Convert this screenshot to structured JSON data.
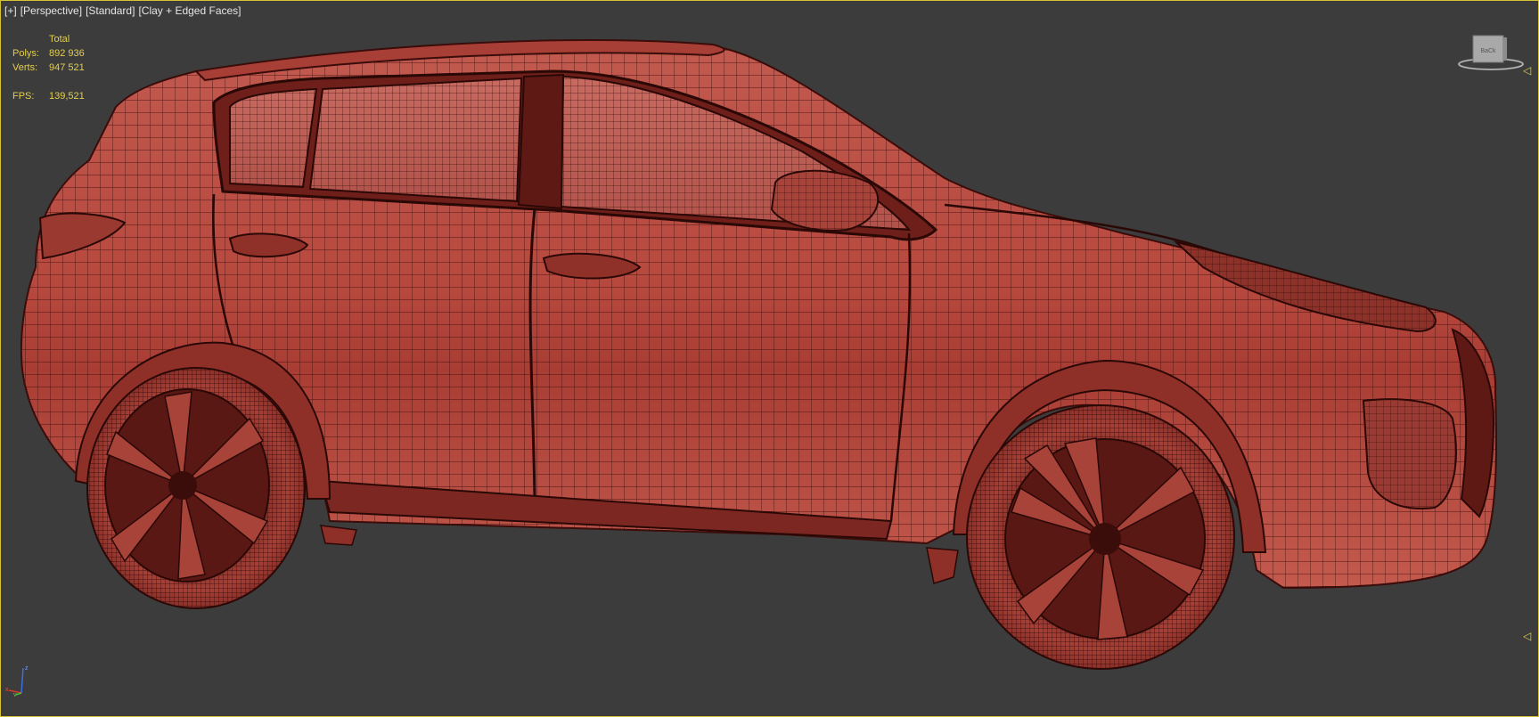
{
  "viewport": {
    "label_plus": "[+]",
    "label_view": "[Perspective]",
    "label_shading_mode": "[Standard]",
    "label_render_mode": "[Clay + Edged Faces]"
  },
  "stats": {
    "header": "Total",
    "polys_label": "Polys:",
    "polys_value": "892 936",
    "verts_label": "Verts:",
    "verts_value": "947 521",
    "fps_label": "FPS:",
    "fps_value": "139,521"
  },
  "viewcube": {
    "face_label": "BaCk"
  },
  "gizmo": {
    "x": "x",
    "y": "y",
    "z": "z"
  },
  "colors": {
    "background": "#3c3c3c",
    "active_border": "#d6c234",
    "stats_text": "#e4cf4a",
    "clay": "#b5493f",
    "wire": "#3a0c0a"
  }
}
